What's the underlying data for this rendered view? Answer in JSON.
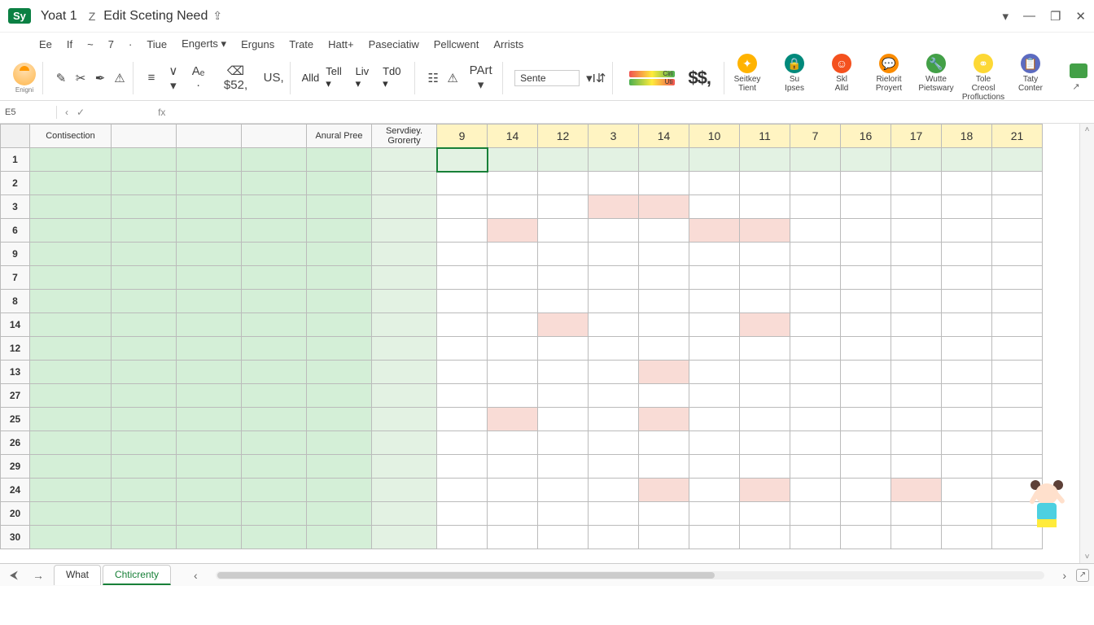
{
  "titlebar": {
    "app_badge": "Sy",
    "doc_title": "Yoat 1",
    "sync_icon": "Z",
    "subtitle": "Edit Sceting Need",
    "share_icon": "⇪",
    "window": {
      "dropdown": "▾",
      "minimize": "—",
      "restore": "❐",
      "close": "✕"
    }
  },
  "menubar": {
    "items": [
      "Ee",
      "If",
      "~",
      "7",
      "·",
      "Tiue",
      "Engerts ▾",
      "Erguns",
      "Trate",
      "Hatt+",
      "Paseciatiw",
      "Pellcwent",
      "Arrists"
    ]
  },
  "toolbar": {
    "small_label": "Enigni",
    "format_glyphs": [
      "✎",
      "✂",
      "✒",
      "⚠"
    ],
    "para_glyphs": [
      "≡",
      "∨ ▾",
      "Aₑ ·",
      "⌫ $52,",
      "US,"
    ],
    "btns": [
      "Alld",
      "Tell ▾",
      "Liv ▾",
      "Td0 ▾"
    ],
    "wrap_glyphs": [
      "☷",
      "⚠",
      "PArt ▾"
    ],
    "font_name": "Sente",
    "font_ctrl": [
      "▾",
      "I",
      "⇵"
    ],
    "cf_labels": {
      "top": "Ciri",
      "bottom": "Uti"
    },
    "currency": "$$,",
    "ext": [
      {
        "icon_cls": "people",
        "glyph": "✦",
        "label1": "Seitkey",
        "label2": "Tient"
      },
      {
        "icon_cls": "lock",
        "glyph": "🔒",
        "label1": "Su",
        "label2": "Ipses"
      },
      {
        "icon_cls": "face",
        "glyph": "☺",
        "label1": "Skl",
        "label2": "Alld"
      },
      {
        "icon_cls": "chat",
        "glyph": "💬",
        "label1": "Rielorit",
        "label2": "Proyert"
      },
      {
        "icon_cls": "wrench",
        "glyph": "🔧",
        "label1": "Wutte",
        "label2": "Pietswary"
      },
      {
        "icon_cls": "rings",
        "glyph": "⚭",
        "label1": "Tole Creosl",
        "label2": "Profluctions"
      },
      {
        "icon_cls": "note",
        "glyph": "📋",
        "label1": "Taty",
        "label2": "Conter"
      }
    ]
  },
  "formulabar": {
    "namebox": "E5",
    "cancel": "‹",
    "accept": "✓",
    "fx": "fx",
    "value": ""
  },
  "columns": {
    "label_headers": [
      "Contisection",
      "",
      "",
      "",
      "Anural Pree",
      "Servdiey. Grorerty"
    ],
    "num_headers": [
      "9",
      "14",
      "12",
      "3",
      "14",
      "10",
      "11",
      "7",
      "16",
      "17",
      "18",
      "21"
    ]
  },
  "rows": [
    "1",
    "2",
    "3",
    "6",
    "9",
    "7",
    "8",
    "14",
    "12",
    "13",
    "27",
    "25",
    "26",
    "29",
    "24",
    "20",
    "30"
  ],
  "pink_cells": {
    "3": [
      9,
      10
    ],
    "6": [
      7,
      11,
      12
    ],
    "14": [
      8,
      12
    ],
    "13": [
      10,
      18
    ],
    "25": [
      7,
      10
    ],
    "24": [
      10,
      12,
      15
    ]
  },
  "selected_cell": {
    "row": "1",
    "col": 6
  },
  "sheettabs": {
    "nav": [
      "⮜",
      "→"
    ],
    "tabs": [
      "What",
      "Chticrenty"
    ],
    "active": 1,
    "explore": "↗"
  }
}
